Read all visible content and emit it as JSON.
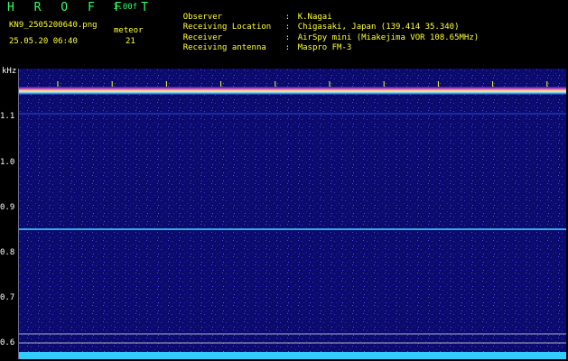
{
  "header": {
    "brand": "H R O F F T",
    "version": "1.00f",
    "filename": "KN9_2505200640.png",
    "meteor_label": "meteor",
    "datetime": "25.05.20 06:40",
    "meteor_count": "21"
  },
  "info": [
    {
      "label": "Observer",
      "sep": ":",
      "value": "K.Nagai"
    },
    {
      "label": "Receiving Location",
      "sep": ":",
      "value": "Chigasaki, Japan (139.414 35.340)"
    },
    {
      "label": "Receiver",
      "sep": ":",
      "value": "AirSpy mini (Miakejima VOR 108.65MHz)"
    },
    {
      "label": "Receiving antenna",
      "sep": ":",
      "value": "Maspro FM-3"
    }
  ],
  "axis": {
    "unit": "kHz",
    "y_ticks": [
      "1.1",
      "1.0",
      "0.9",
      "0.8",
      "0.7",
      "0.6"
    ],
    "time_ticks": [
      "0641",
      "0642",
      "0643",
      "0644",
      "0645",
      "0646",
      "0647",
      "0648",
      "0649",
      "0650"
    ]
  },
  "colors": {
    "background": "#000000",
    "plot_bg": "#0b0b6e",
    "label_yellow": "#ffff33",
    "brand_green": "#33ff66",
    "trace_cyan": "#33ccff"
  }
}
